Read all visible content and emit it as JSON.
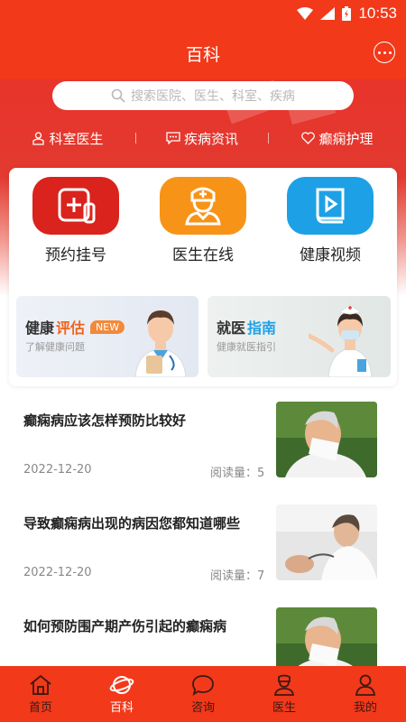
{
  "status": {
    "time": "10:53"
  },
  "header": {
    "title": "百科"
  },
  "search": {
    "placeholder": "搜索医院、医生、科室、疾病"
  },
  "categories": [
    {
      "label": "科室医生",
      "icon": "doctor-badge-icon"
    },
    {
      "label": "疾病资讯",
      "icon": "chat-icon"
    },
    {
      "label": "癫痫护理",
      "icon": "heart-icon"
    }
  ],
  "features": [
    {
      "label": "预约挂号",
      "icon": "calendar-plus-icon",
      "color": "#d9231c"
    },
    {
      "label": "医生在线",
      "icon": "doctor-icon",
      "color": "#f79418"
    },
    {
      "label": "健康视频",
      "icon": "video-book-icon",
      "color": "#1ea0e6"
    }
  ],
  "promos": [
    {
      "title_a": "健康",
      "title_b": "评估",
      "badge": "NEW",
      "subtitle": "了解健康问题",
      "accent": "#f2631a"
    },
    {
      "title_a": "就医",
      "title_b": "指南",
      "subtitle": "健康就医指引",
      "accent": "#1ea0e6"
    }
  ],
  "articles": [
    {
      "title": "癫痫病应该怎样预防比较好",
      "date": "2022-12-20",
      "reads": "阅读量：5"
    },
    {
      "title": "导致癫痫病出现的病因您都知道哪些",
      "date": "2022-12-20",
      "reads": "阅读量：7"
    },
    {
      "title": "如何预防围产期产伤引起的癫痫病",
      "date": "",
      "reads": ""
    }
  ],
  "tabs": [
    {
      "label": "首页",
      "icon": "home-icon"
    },
    {
      "label": "百科",
      "icon": "planet-icon",
      "active": true
    },
    {
      "label": "咨询",
      "icon": "chat-bubble-icon"
    },
    {
      "label": "医生",
      "icon": "doctor-person-icon"
    },
    {
      "label": "我的",
      "icon": "user-icon"
    }
  ]
}
